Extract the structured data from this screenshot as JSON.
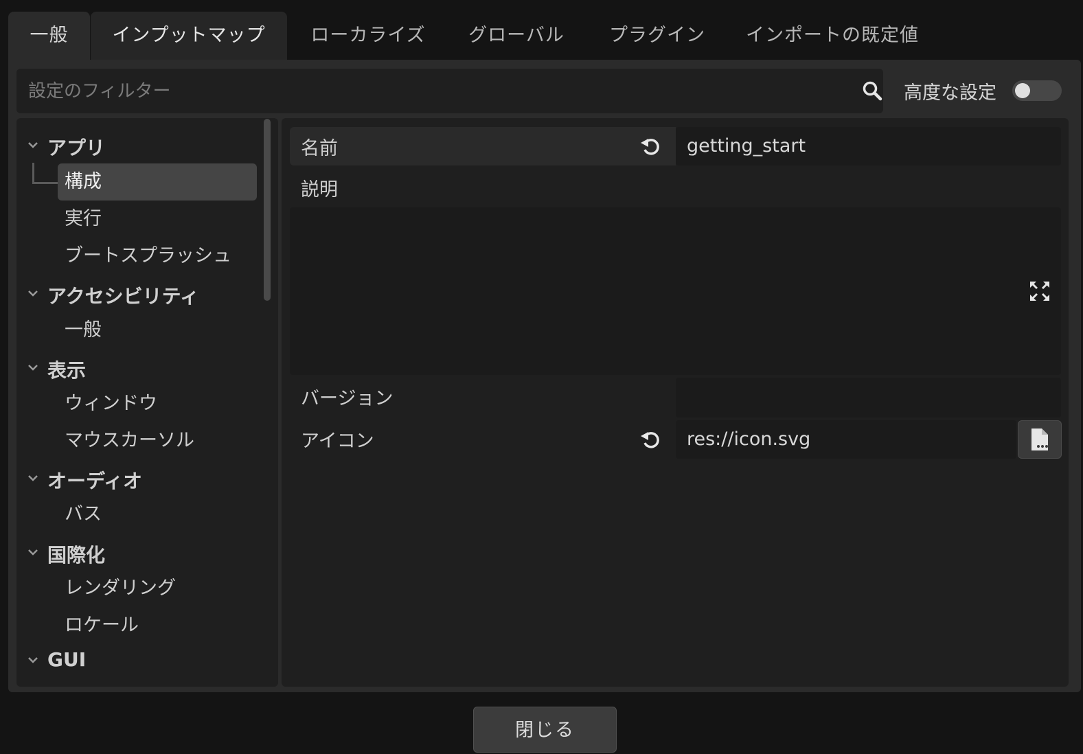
{
  "tabs": [
    {
      "label": "一般"
    },
    {
      "label": "インプットマップ"
    },
    {
      "label": "ローカライズ"
    },
    {
      "label": "グローバル"
    },
    {
      "label": "プラグイン"
    },
    {
      "label": "インポートの既定値"
    }
  ],
  "search": {
    "placeholder": "設定のフィルター",
    "value": ""
  },
  "advanced": {
    "label": "高度な設定",
    "enabled": false
  },
  "tree": {
    "categories": [
      {
        "label": "アプリ",
        "items": [
          "構成",
          "実行",
          "ブートスプラッシュ"
        ]
      },
      {
        "label": "アクセシビリティ",
        "items": [
          "一般"
        ]
      },
      {
        "label": "表示",
        "items": [
          "ウィンドウ",
          "マウスカーソル"
        ]
      },
      {
        "label": "オーディオ",
        "items": [
          "バス"
        ]
      },
      {
        "label": "国際化",
        "items": [
          "レンダリング",
          "ロケール"
        ]
      },
      {
        "label": "GUI",
        "items": []
      }
    ],
    "selected": "構成"
  },
  "properties": {
    "name": {
      "label": "名前",
      "value": "getting_start"
    },
    "description": {
      "label": "説明",
      "value": ""
    },
    "version": {
      "label": "バージョン",
      "value": ""
    },
    "icon": {
      "label": "アイコン",
      "value": "res://icon.svg"
    }
  },
  "footer": {
    "close_label": "閉じる"
  },
  "icons": {
    "search": "search-icon",
    "revert": "revert-icon",
    "expand": "expand-icon",
    "file": "file-icon",
    "chevron": "chevron-down-icon"
  }
}
